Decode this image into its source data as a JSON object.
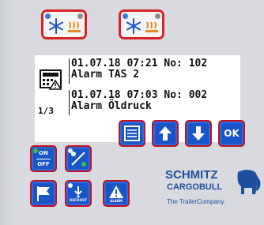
{
  "status_icons": [
    {
      "name": "refrigeration-heat-status-1"
    },
    {
      "name": "refrigeration-heat-status-2"
    }
  ],
  "display": {
    "page_indicator": "1/3",
    "alarms": [
      {
        "line1": "01.07.18 07:21 No: 102",
        "line2": "Alarm TAS 2"
      },
      {
        "line1": "01.07.18 07:03 No: 002",
        "line2": "Alarm Öldruck"
      }
    ]
  },
  "buttons": {
    "ok": "OK",
    "on_off_top": "ON",
    "on_off_bottom": "OFF",
    "defrost": "DEFROST",
    "alarm": "ALARM"
  },
  "logo": {
    "line1": "SCHMITZ",
    "line2": "CARGOBULL",
    "tagline": "The TrailerCompany."
  },
  "colors": {
    "button_blue": "#1a55c8",
    "accent_red": "#d9242a",
    "panel": "#d8dadf"
  }
}
